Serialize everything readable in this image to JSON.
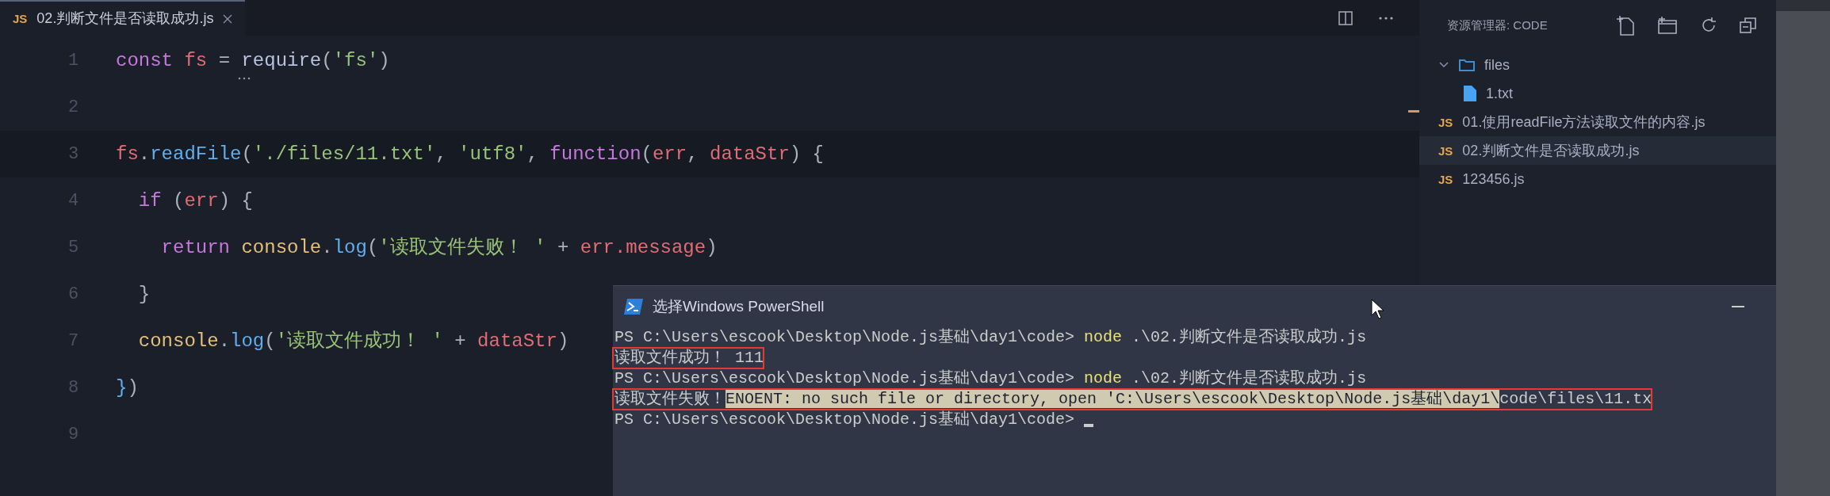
{
  "tab": {
    "badge": "JS",
    "label": "02.判断文件是否读取成功.js",
    "selected": true
  },
  "code": [
    {
      "number": "1",
      "current": false,
      "fold_hint": true,
      "tokens": [
        {
          "kind": "keyword",
          "text": "const "
        },
        {
          "kind": "variable",
          "text": "fs"
        },
        {
          "kind": "plain",
          "text": " = "
        },
        {
          "kind": "call",
          "text": "require"
        },
        {
          "kind": "plain",
          "text": "("
        },
        {
          "kind": "string",
          "text": "'fs'"
        },
        {
          "kind": "plain",
          "text": ")"
        }
      ]
    },
    {
      "number": "2",
      "current": false,
      "fold_hint": false
    },
    {
      "number": "3",
      "current": true,
      "fold_hint": false,
      "tokens": [
        {
          "kind": "variable",
          "text": "fs"
        },
        {
          "kind": "plain",
          "text": "."
        },
        {
          "kind": "func",
          "text": "readFile"
        },
        {
          "kind": "plain",
          "text": "("
        },
        {
          "kind": "string",
          "text": "'./files/11.txt'"
        },
        {
          "kind": "plain",
          "text": ", "
        },
        {
          "kind": "string",
          "text": "'utf8'"
        },
        {
          "kind": "plain",
          "text": ", "
        },
        {
          "kind": "keyword",
          "text": "function"
        },
        {
          "kind": "plain",
          "text": "("
        },
        {
          "kind": "variable",
          "text": "err"
        },
        {
          "kind": "plain",
          "text": ", "
        },
        {
          "kind": "variable",
          "text": "dataStr"
        },
        {
          "kind": "plain",
          "text": ") {"
        }
      ]
    },
    {
      "number": "4",
      "current": false,
      "fold_hint": false,
      "tokens": [
        {
          "kind": "keyword",
          "text": "  if"
        },
        {
          "kind": "plain",
          "text": " ("
        },
        {
          "kind": "variable",
          "text": "err"
        },
        {
          "kind": "plain",
          "text": ") {"
        }
      ]
    },
    {
      "number": "5",
      "current": false,
      "fold_hint": false,
      "tokens": [
        {
          "kind": "keyword",
          "text": "    return "
        },
        {
          "kind": "object",
          "text": "console"
        },
        {
          "kind": "plain",
          "text": "."
        },
        {
          "kind": "func",
          "text": "log"
        },
        {
          "kind": "plain",
          "text": "("
        },
        {
          "kind": "string",
          "text": "'读取文件失败！ '"
        },
        {
          "kind": "plain",
          "text": " + "
        },
        {
          "kind": "variable",
          "text": "err.message"
        },
        {
          "kind": "plain",
          "text": ")"
        }
      ]
    },
    {
      "number": "6",
      "current": false,
      "fold_hint": false,
      "tokens": [
        {
          "kind": "plain",
          "text": "  }"
        }
      ]
    },
    {
      "number": "7",
      "current": false,
      "fold_hint": false,
      "tokens": [
        {
          "kind": "object",
          "text": "  console"
        },
        {
          "kind": "plain",
          "text": "."
        },
        {
          "kind": "func",
          "text": "log"
        },
        {
          "kind": "plain",
          "text": "("
        },
        {
          "kind": "string",
          "text": "'读取文件成功！ '"
        },
        {
          "kind": "plain",
          "text": " + "
        },
        {
          "kind": "variable",
          "text": "dataStr"
        },
        {
          "kind": "plain",
          "text": ")"
        }
      ]
    },
    {
      "number": "8",
      "current": false,
      "fold_hint": false,
      "tokens": [
        {
          "kind": "func",
          "text": "}"
        },
        {
          "kind": "plain",
          "text": ")"
        }
      ]
    },
    {
      "number": "9",
      "current": false,
      "fold_hint": false
    }
  ],
  "explorer": {
    "title": "资源管理器: CODE",
    "items": [
      {
        "kind": "folder",
        "label": "files",
        "expanded": true,
        "selected": false,
        "children": [
          {
            "kind": "file",
            "label": "1.txt",
            "selected": false
          }
        ]
      },
      {
        "kind": "js",
        "badge": "JS",
        "label": "01.使用readFile方法读取文件的内容.js",
        "selected": false
      },
      {
        "kind": "js",
        "badge": "JS",
        "label": "02.判断文件是否读取成功.js",
        "selected": true
      },
      {
        "kind": "js",
        "badge": "JS",
        "label": "123456.js",
        "selected": false
      }
    ]
  },
  "terminal": {
    "title": "选择Windows PowerShell",
    "lines": [
      {
        "boxed": false,
        "cursor": false,
        "segments": [
          {
            "kind": "plain",
            "text": "PS C:\\Users\\escook\\Desktop\\Node.js基础\\day1\\code> "
          },
          {
            "kind": "command",
            "text": "node"
          },
          {
            "kind": "plain",
            "text": " .\\02.判断文件是否读取成功.js"
          }
        ]
      },
      {
        "boxed": true,
        "cursor": false,
        "segments": [
          {
            "kind": "plain",
            "text": "读取文件成功！ 111"
          }
        ]
      },
      {
        "boxed": false,
        "cursor": false,
        "segments": [
          {
            "kind": "plain",
            "text": "PS C:\\Users\\escook\\Desktop\\Node.js基础\\day1\\code> "
          },
          {
            "kind": "command",
            "text": "node"
          },
          {
            "kind": "plain",
            "text": " .\\02.判断文件是否读取成功.js"
          }
        ]
      },
      {
        "boxed": true,
        "cursor": false,
        "segments": [
          {
            "kind": "plain",
            "text": "读取文件失败！"
          },
          {
            "kind": "selected",
            "text": "ENOENT: no such file or directory, open 'C:\\Users\\escook\\Desktop\\Node.js基础\\day1\\"
          },
          {
            "kind": "plain",
            "text": "code\\files\\11.tx"
          }
        ]
      },
      {
        "boxed": false,
        "cursor": true,
        "segments": [
          {
            "kind": "plain",
            "text": "PS C:\\Users\\escook\\Desktop\\Node.js基础\\day1\\code> "
          }
        ]
      }
    ]
  }
}
